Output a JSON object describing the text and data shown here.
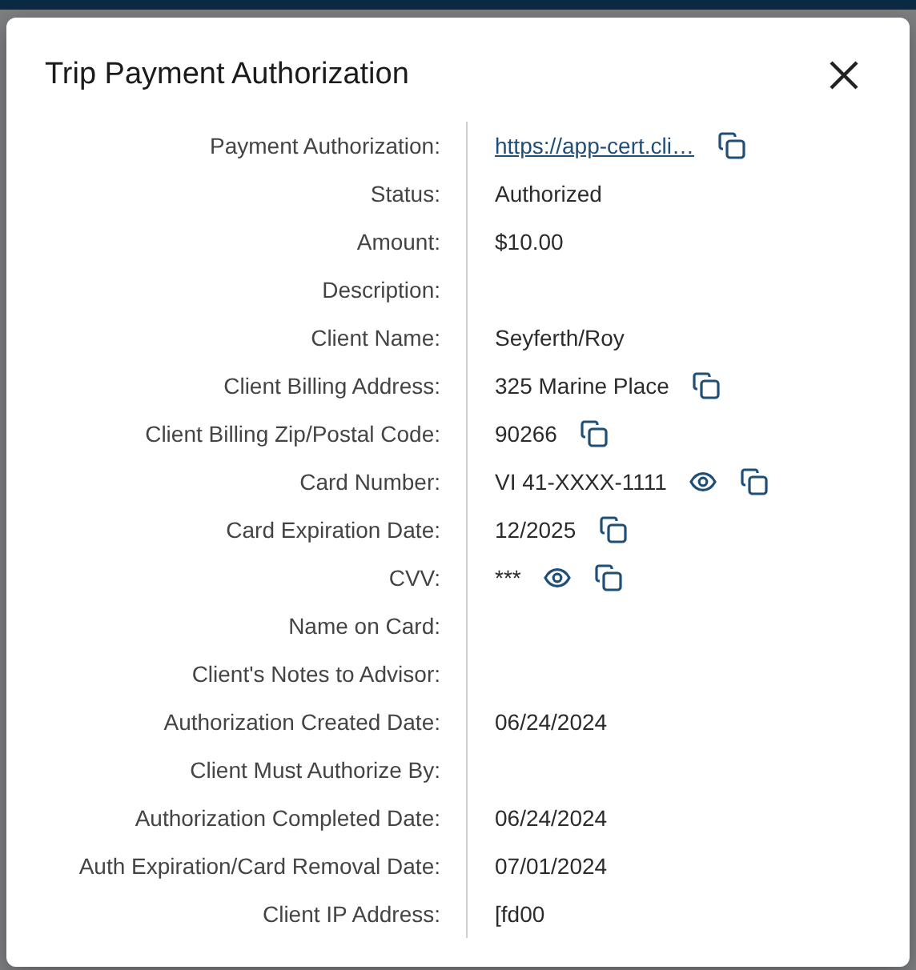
{
  "dialog": {
    "title": "Trip Payment Authorization",
    "fields": [
      {
        "label": "Payment Authorization:",
        "value": "https://app-cert.cli…",
        "kind": "link",
        "copyable": true
      },
      {
        "label": "Status:",
        "value": "Authorized",
        "kind": "text"
      },
      {
        "label": "Amount:",
        "value": "$10.00",
        "kind": "text"
      },
      {
        "label": "Description:"
      },
      {
        "label": "Client Name:",
        "value": "Seyferth/Roy",
        "kind": "text"
      },
      {
        "label": "Client Billing Address:",
        "value": "325 Marine Place",
        "kind": "text",
        "copyable": true
      },
      {
        "label": "Client Billing Zip/Postal Code:",
        "value": "90266",
        "kind": "text",
        "copyable": true
      },
      {
        "label": "Card Number:",
        "value": "VI 41-XXXX-1111",
        "kind": "text",
        "revealable": true,
        "copyable": true
      },
      {
        "label": "Card Expiration Date:",
        "value": "12/2025",
        "kind": "text",
        "copyable": true
      },
      {
        "label": "CVV:",
        "value": "***",
        "kind": "text",
        "revealable": true,
        "copyable": true
      },
      {
        "label": "Name on Card:"
      },
      {
        "label": "Client's Notes to Advisor:"
      },
      {
        "label": "Authorization Created Date:",
        "value": "06/24/2024",
        "kind": "text"
      },
      {
        "label": "Client Must Authorize By:"
      },
      {
        "label": "Authorization Completed Date:",
        "value": "06/24/2024",
        "kind": "text"
      },
      {
        "label": "Auth Expiration/Card Removal Date:",
        "value": "07/01/2024",
        "kind": "text"
      },
      {
        "label": "Client IP Address:",
        "value": "[fd00",
        "kind": "text"
      }
    ]
  }
}
